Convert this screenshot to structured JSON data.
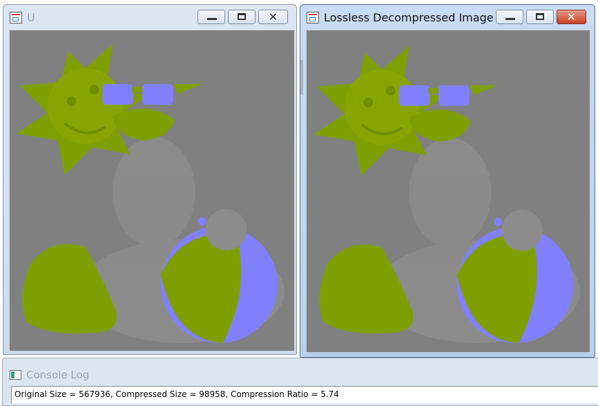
{
  "windows": [
    {
      "id": "source",
      "title": "U",
      "active": false,
      "buttons": {
        "minimize": "minimize-icon",
        "maximize": "maximize-icon",
        "close": "close-icon"
      }
    },
    {
      "id": "decompressed",
      "title": "Lossless Decompressed Image",
      "active": true,
      "buttons": {
        "minimize": "minimize-icon",
        "maximize": "maximize-icon",
        "close": "close-icon"
      }
    }
  ],
  "image": {
    "background": "#808080",
    "primary_color": "#7f9f00",
    "accent_color": "#8080ff",
    "content": [
      "sun-with-face",
      "duck-with-sunglasses",
      "beach-ball"
    ]
  },
  "console": {
    "title": "Console Log",
    "message": "Original Size = 567936, Compressed Size = 98958, Compression Ratio = 5.74"
  },
  "icons": {
    "window": "app-image-icon",
    "close_glyph": "✕",
    "console": "console-icon"
  }
}
